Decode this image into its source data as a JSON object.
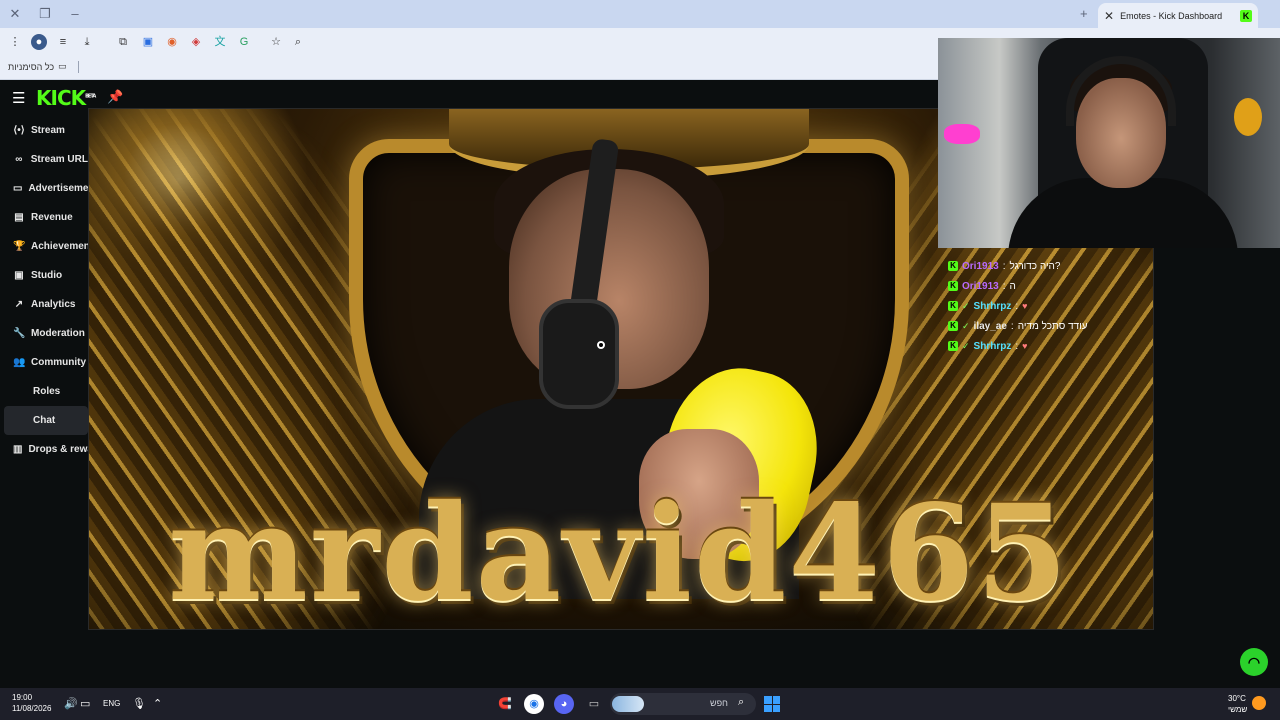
{
  "browser": {
    "tab_title": "Emotes - Kick Dashboard",
    "tab_favicon": "K",
    "bookmarks_label": "כל הסימניות"
  },
  "app": {
    "logo": "KICK",
    "logo_badge": "BETA",
    "sidebar": [
      {
        "label": "Stream",
        "icon": "broadcast-icon"
      },
      {
        "label": "Stream URL",
        "icon": "link-icon"
      },
      {
        "label": "Advertisements",
        "icon": "ad-icon"
      },
      {
        "label": "Revenue",
        "icon": "revenue-icon"
      },
      {
        "label": "Achievements",
        "icon": "trophy-icon"
      },
      {
        "label": "Studio",
        "icon": "studio-icon"
      },
      {
        "label": "Analytics",
        "icon": "analytics-icon"
      },
      {
        "label": "Moderation",
        "icon": "wrench-icon"
      },
      {
        "label": "Community",
        "icon": "community-icon"
      },
      {
        "label": "Roles",
        "icon": ""
      },
      {
        "label": "Chat",
        "icon": ""
      },
      {
        "label": "Drops & rewards",
        "icon": "drops-icon"
      }
    ],
    "stage_title": "mrdavid465"
  },
  "chat": [
    {
      "user": "Ori1913",
      "message": "היה כדורגל?",
      "emote": false,
      "color": "purple"
    },
    {
      "user": "Ori1913",
      "message": "ה",
      "emote": false,
      "color": "purple"
    },
    {
      "user": "Shrhrpz",
      "message": "",
      "emote": true,
      "color": "cyan"
    },
    {
      "user": "ilay_ae",
      "message": "עודד סתכל מדיה",
      "emote": false,
      "color": "white"
    },
    {
      "user": "Shrhrpz",
      "message": "",
      "emote": true,
      "color": "cyan"
    }
  ],
  "taskbar": {
    "time": "19:00",
    "date": "11/08/2026",
    "lang": "ENG",
    "search_label": "חפש",
    "temperature": "30°C",
    "weather_label": "שמשי"
  },
  "colors": {
    "kick_green": "#53fc18",
    "chat_purple": "#b86bff",
    "chat_cyan": "#54e0ff"
  }
}
